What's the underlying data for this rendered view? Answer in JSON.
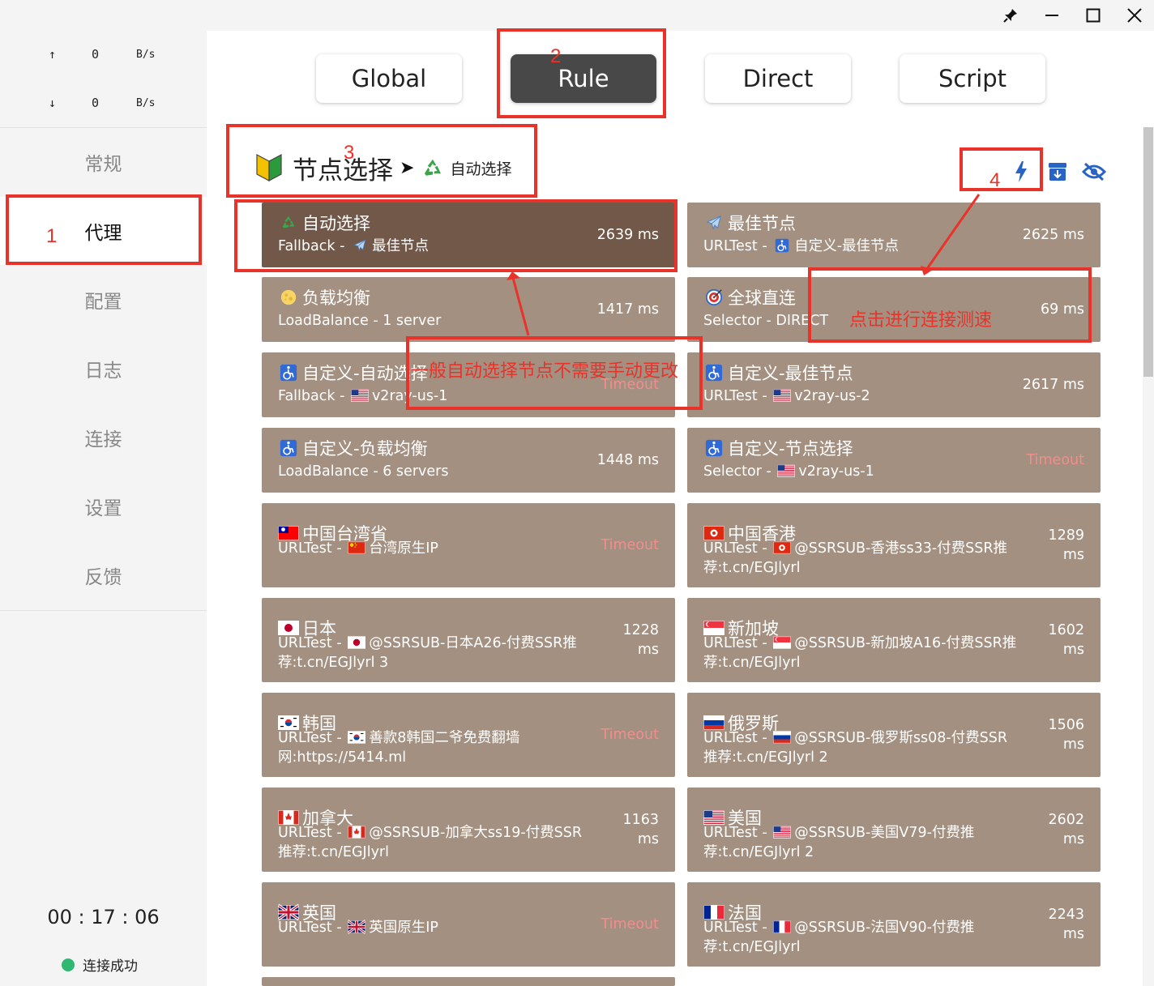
{
  "window": {
    "pin_icon": "pin-icon",
    "minimize_icon": "minimize-icon",
    "maximize_icon": "maximize-icon",
    "close_icon": "close-icon"
  },
  "traffic": {
    "upload": {
      "arrow": "↑",
      "value": "0",
      "unit": "B/s"
    },
    "download": {
      "arrow": "↓",
      "value": "0",
      "unit": "B/s"
    }
  },
  "nav": [
    "常规",
    "代理",
    "配置",
    "日志",
    "连接",
    "设置",
    "反馈"
  ],
  "nav_active": "代理",
  "timer": "00 : 17 : 06",
  "status": {
    "label": "连接成功",
    "color": "#2eb872"
  },
  "modes": [
    "Global",
    "Rule",
    "Direct",
    "Script"
  ],
  "mode_active": "Rule",
  "group": {
    "name": "节点选择",
    "arrow": "➤",
    "current": "自动选择"
  },
  "header_icons": [
    "lightning-icon",
    "archive-down-icon",
    "eye-slash-icon"
  ],
  "colors": {
    "card": "#a39081",
    "card_selected": "#725848",
    "mode_active": "#484848",
    "timeout": "#f28d8d",
    "annotation": "#e8332a"
  },
  "proxies": [
    {
      "name": "自动选择",
      "icon": "recycle",
      "type": "Fallback",
      "sep": " - ",
      "now_icon": "airplane",
      "now": "最佳节点",
      "latency": "2639 ms",
      "selected": true
    },
    {
      "name": "最佳节点",
      "icon": "airplane",
      "type": "URLTest",
      "sep": " - ",
      "now_icon": "accessible",
      "now": "自定义-最佳节点",
      "latency": "2625 ms"
    },
    {
      "name": "负载均衡",
      "icon": "moon",
      "type": "LoadBalance",
      "sep": " - ",
      "now": "1 server",
      "latency": "1417 ms"
    },
    {
      "name": "全球直连",
      "icon": "target",
      "type": "Selector",
      "sep": " - ",
      "now": "DIRECT",
      "latency": "69 ms"
    },
    {
      "name": "自定义-自动选择",
      "icon": "accessible",
      "type": "Fallback",
      "sep": " - ",
      "now_icon": "us",
      "now": "v2ray-us-1",
      "latency": "Timeout",
      "timeout": true
    },
    {
      "name": "自定义-最佳节点",
      "icon": "accessible",
      "type": "URLTest",
      "sep": " - ",
      "now_icon": "us",
      "now": "v2ray-us-2",
      "latency": "2617 ms"
    },
    {
      "name": "自定义-负载均衡",
      "icon": "accessible",
      "type": "LoadBalance",
      "sep": " - ",
      "now": "6 servers",
      "latency": "1448 ms"
    },
    {
      "name": "自定义-节点选择",
      "icon": "accessible",
      "type": "Selector",
      "sep": " - ",
      "now_icon": "us",
      "now": "v2ray-us-1",
      "latency": "Timeout",
      "timeout": true
    },
    {
      "name": "中国台湾省",
      "icon": "tw",
      "type": "URLTest",
      "sep": " - ",
      "now_icon": "cn",
      "now": "台湾原生IP",
      "latency": "Timeout",
      "timeout": true
    },
    {
      "name": "中国香港",
      "icon": "hk",
      "type": "URLTest",
      "sep": " - ",
      "now_icon": "hk",
      "now": "@SSRSUB-香港ss33-付费SSR推荐:t.cn/EGJlyrl",
      "latency": "1289 ms"
    },
    {
      "name": "日本",
      "icon": "jp",
      "type": "URLTest",
      "sep": " - ",
      "now_icon": "jp",
      "now": "@SSRSUB-日本A26-付费SSR推荐:t.cn/EGJlyrl 3",
      "latency": "1228 ms"
    },
    {
      "name": "新加坡",
      "icon": "sg",
      "type": "URLTest",
      "sep": " - ",
      "now_icon": "sg",
      "now": "@SSRSUB-新加坡A16-付费SSR推荐:t.cn/EGJlyrl",
      "latency": "1602 ms"
    },
    {
      "name": "韩国",
      "icon": "kr",
      "type": "URLTest",
      "sep": " - ",
      "now_icon": "kr",
      "now": "善款8韩国二爷免费翻墙网:https://5414.ml",
      "latency": "Timeout",
      "timeout": true
    },
    {
      "name": "俄罗斯",
      "icon": "ru",
      "type": "URLTest",
      "sep": " - ",
      "now_icon": "ru",
      "now": "@SSRSUB-俄罗斯ss08-付费SSR推荐:t.cn/EGJlyrl 2",
      "latency": "1506 ms"
    },
    {
      "name": "加拿大",
      "icon": "ca",
      "type": "URLTest",
      "sep": " - ",
      "now_icon": "ca",
      "now": "@SSRSUB-加拿大ss19-付费SSR推荐:t.cn/EGJlyrl",
      "latency": "1163 ms"
    },
    {
      "name": "美国",
      "icon": "us",
      "type": "URLTest",
      "sep": " - ",
      "now_icon": "us",
      "now": "@SSRSUB-美国V79-付费推荐:t.cn/EGJlyrl 2",
      "latency": "2602 ms"
    },
    {
      "name": "英国",
      "icon": "gb",
      "type": "URLTest",
      "sep": " - ",
      "now_icon": "gb",
      "now": "英国原生IP",
      "latency": "Timeout",
      "timeout": true
    },
    {
      "name": "法国",
      "icon": "fr",
      "type": "URLTest",
      "sep": " - ",
      "now_icon": "fr",
      "now": "@SSRSUB-法国V90-付费推荐:t.cn/EGJlyrl",
      "latency": "2243 ms"
    }
  ],
  "annotations": {
    "num1": "1",
    "num2": "2",
    "num3": "3",
    "num4": "4",
    "note_auto": "一般自动选择节点不需要手动更改",
    "note_test": "点击进行连接测速"
  }
}
